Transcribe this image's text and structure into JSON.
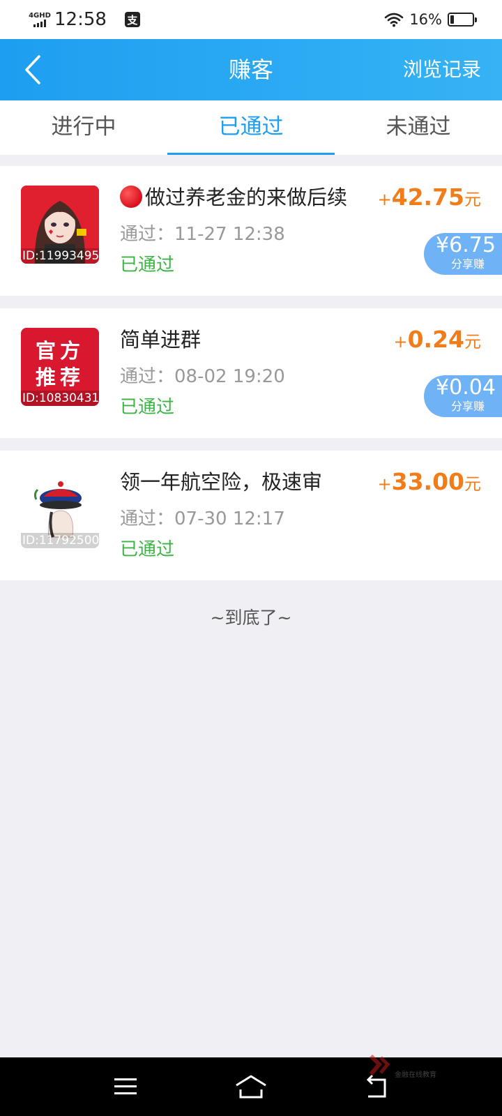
{
  "status_bar": {
    "network": "4GHD",
    "time": "12:58",
    "app_badge": "支",
    "battery_percent": "16%",
    "battery_level": 0.16
  },
  "header": {
    "title": "赚客",
    "history_label": "浏览记录"
  },
  "tabs": [
    {
      "label": "进行中",
      "active": false
    },
    {
      "label": "已通过",
      "active": true
    },
    {
      "label": "未通过",
      "active": false
    }
  ],
  "tasks": [
    {
      "title": "做过养老金的来做后续",
      "id_label": "ID:11993495",
      "pass_time": "通过：11-27 12:38",
      "status": "已通过",
      "amount_plus": "+",
      "amount": "42.75",
      "amount_unit": "元",
      "share_value": "¥6.75",
      "share_label": "分享赚"
    },
    {
      "title": "简单进群",
      "id_label": "ID:10830431",
      "thumb_text_1": "官方",
      "thumb_text_2": "推荐",
      "pass_time": "通过：08-02 19:20",
      "status": "已通过",
      "amount_plus": "+",
      "amount": "0.24",
      "amount_unit": "元",
      "share_value": "¥0.04",
      "share_label": "分享赚"
    },
    {
      "title": "领一年航空险，极速审",
      "id_label": "ID:11792500",
      "pass_time": "通过：07-30 12:17",
      "status": "已通过",
      "amount_plus": "+",
      "amount": "33.00",
      "amount_unit": "元"
    }
  ],
  "end_text": "~到底了~",
  "watermark_text": "金融在线教育",
  "colors": {
    "primary": "#1e9ef0",
    "amount": "#f07d1a",
    "status_green": "#3cb446",
    "share_badge": "#6fb2f5",
    "official_red": "#d8182e"
  }
}
